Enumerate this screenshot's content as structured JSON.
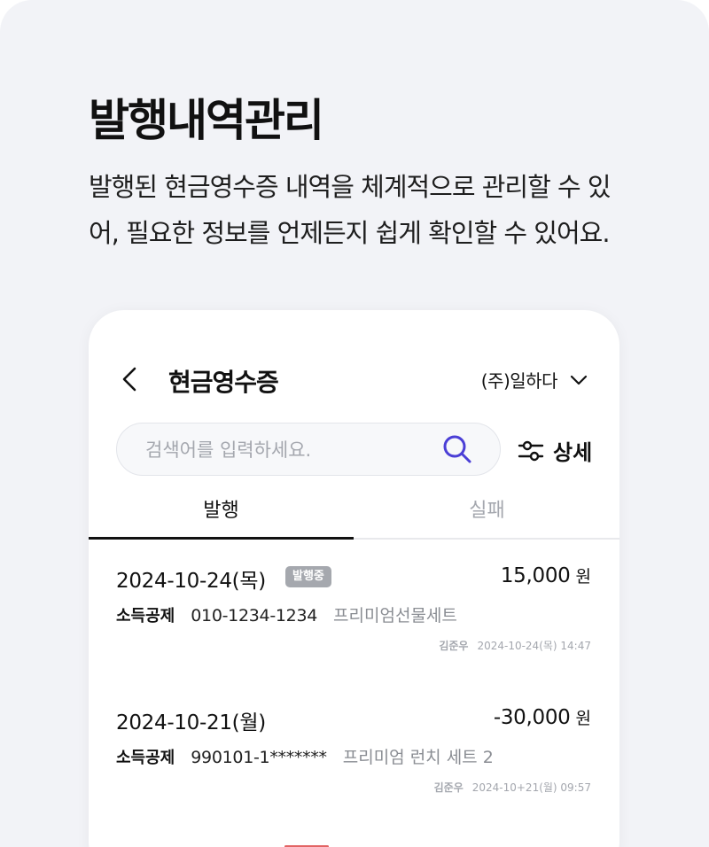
{
  "headline": "발행내역관리",
  "description": "발행된 현금영수증 내역을 체계적으로 관리할 수 있어, 필요한 정보를 언제든지 쉽게 확인할 수 있어요.",
  "screen": {
    "title": "현금영수증",
    "company": "(주)일하다",
    "search": {
      "placeholder": "검색어를 입력하세요."
    },
    "detail_label": "상세",
    "tabs": [
      {
        "label": "발행",
        "active": true
      },
      {
        "label": "실패",
        "active": false
      }
    ],
    "records": [
      {
        "date": "2024-10-24(목)",
        "badge": "발행중",
        "amount": "15,000",
        "unit": "원",
        "type": "소득공제",
        "id_number": "010-1234-1234",
        "product": "프리미엄선물세트",
        "user": "김준우",
        "timestamp": "2024-10-24(목) 14:47"
      },
      {
        "date": "2024-10-21(월)",
        "badge": "",
        "amount": "-30,000",
        "unit": "원",
        "type": "소득공제",
        "id_number": "990101-1*******",
        "product": "프리미엄 런치 세트 2",
        "user": "김준우",
        "timestamp": "2024-10+21(월) 09:57"
      }
    ]
  },
  "colors": {
    "background": "#f2f3f7",
    "search_icon": "#4b3fd6",
    "badge": "#a5a8ae",
    "text_muted": "#a4a7ae"
  },
  "icons": {
    "back": "chevron-left-icon",
    "dropdown": "chevron-down-icon",
    "search": "search-icon",
    "filter": "sliders-icon"
  }
}
